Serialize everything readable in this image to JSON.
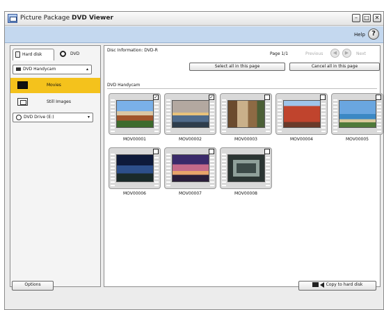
{
  "window": {
    "title_prefix": "Picture Package ",
    "title_bold": "DVD Viewer",
    "minimize_glyph": "–",
    "maximize_glyph": "□",
    "close_glyph": "✕"
  },
  "menu": {
    "help_label": "Help",
    "help_icon_glyph": "?"
  },
  "left_panel": {
    "tabs": [
      {
        "label": "Hard disk",
        "icon": "hard-disk-icon",
        "selected": true
      },
      {
        "label": "DVD",
        "icon": "dvd-disc-icon",
        "selected": false
      }
    ],
    "source_dropdown": {
      "value": "DVD Handycam",
      "icon": "camcorder-icon",
      "caret": "▴"
    },
    "nav_items": [
      {
        "label": "Movies",
        "icon": "movie-film-icon",
        "selected": true
      },
      {
        "label": "Still Images",
        "icon": "still-image-icon",
        "selected": false
      }
    ],
    "drive_dropdown": {
      "value": "DVD Drive (E:)",
      "icon": "disc-icon",
      "caret": "▾"
    }
  },
  "right_panel": {
    "disc_info": "Disc Information: DVD-R",
    "page_info": "Page 1/1",
    "previous_label": "Previous",
    "next_label": "Next",
    "select_all_label": "Select all in this page",
    "cancel_all_label": "Cancel all in this page",
    "section_label": "DVD Handycam",
    "thumbnails": [
      {
        "caption": "MOV00001",
        "checked": true,
        "scene": "beach-houses"
      },
      {
        "caption": "MOV00002",
        "checked": true,
        "scene": "sunset-sea"
      },
      {
        "caption": "MOV00003",
        "checked": false,
        "scene": "street"
      },
      {
        "caption": "MOV00004",
        "checked": false,
        "scene": "red-building"
      },
      {
        "caption": "MOV00005",
        "checked": false,
        "scene": "coast"
      },
      {
        "caption": "MOV00006",
        "checked": false,
        "scene": "night-trees"
      },
      {
        "caption": "MOV00007",
        "checked": false,
        "scene": "dusk-sky"
      },
      {
        "caption": "MOV00008",
        "checked": false,
        "scene": "screen"
      }
    ]
  },
  "footer": {
    "options_label": "Options",
    "copy_label": "Copy to hard disk"
  },
  "colors": {
    "selected_nav": "#f4c21c",
    "menu_band": "#c4d8ef"
  }
}
